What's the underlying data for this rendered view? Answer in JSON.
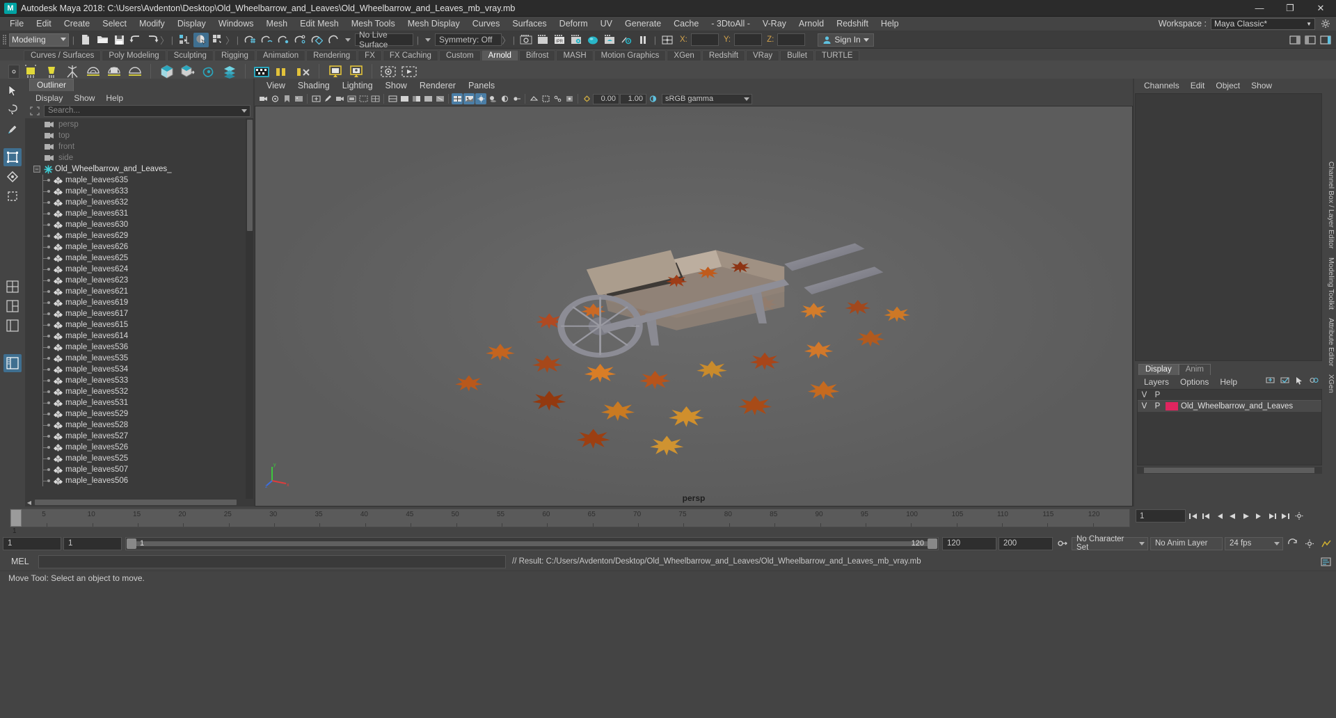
{
  "titlebar": {
    "logo": "M",
    "title": "Autodesk Maya 2018: C:\\Users\\Avdenton\\Desktop\\Old_Wheelbarrow_and_Leaves\\Old_Wheelbarrow_and_Leaves_mb_vray.mb",
    "minimize": "—",
    "maximize": "❐",
    "close": "✕"
  },
  "menubar": {
    "items": [
      "File",
      "Edit",
      "Create",
      "Select",
      "Modify",
      "Display",
      "Windows",
      "Mesh",
      "Edit Mesh",
      "Mesh Tools",
      "Mesh Display",
      "Curves",
      "Surfaces",
      "Deform",
      "UV",
      "Generate",
      "Cache",
      "- 3DtoAll -",
      "V-Ray",
      "Arnold",
      "Redshift",
      "Help"
    ],
    "workspace_label": "Workspace :",
    "workspace_value": "Maya Classic*"
  },
  "statusline": {
    "mode": "Modeling",
    "live_surface": "No Live Surface",
    "symmetry": "Symmetry: Off",
    "axis_x": "X:",
    "axis_y": "Y:",
    "axis_z": "Z:",
    "axis_x_value": "",
    "axis_y_value": "",
    "axis_z_value": "",
    "signin": "Sign In"
  },
  "shelf": {
    "tabs": [
      "Curves / Surfaces",
      "Poly Modeling",
      "Sculpting",
      "Rigging",
      "Animation",
      "Rendering",
      "FX",
      "FX Caching",
      "Custom",
      "Arnold",
      "Bifrost",
      "MASH",
      "Motion Graphics",
      "XGen",
      "Redshift",
      "VRay",
      "Bullet",
      "TURTLE"
    ],
    "active_tab": "Arnold"
  },
  "outliner": {
    "tab": "Outliner",
    "menus": [
      "Display",
      "Show",
      "Help"
    ],
    "search_placeholder": "Search...",
    "cameras": [
      "persp",
      "top",
      "front",
      "side"
    ],
    "group": "Old_Wheelbarrow_and_Leaves_",
    "children": [
      "maple_leaves635",
      "maple_leaves633",
      "maple_leaves632",
      "maple_leaves631",
      "maple_leaves630",
      "maple_leaves629",
      "maple_leaves626",
      "maple_leaves625",
      "maple_leaves624",
      "maple_leaves623",
      "maple_leaves621",
      "maple_leaves619",
      "maple_leaves617",
      "maple_leaves615",
      "maple_leaves614",
      "maple_leaves536",
      "maple_leaves535",
      "maple_leaves534",
      "maple_leaves533",
      "maple_leaves532",
      "maple_leaves531",
      "maple_leaves529",
      "maple_leaves528",
      "maple_leaves527",
      "maple_leaves526",
      "maple_leaves525",
      "maple_leaves507",
      "maple_leaves506"
    ]
  },
  "viewport": {
    "menus": [
      "View",
      "Shading",
      "Lighting",
      "Show",
      "Renderer",
      "Panels"
    ],
    "exposure": "0.00",
    "gamma_value": "1.00",
    "color_space": "sRGB gamma",
    "camera_label": "persp",
    "axis_x": "x",
    "axis_y": "y",
    "axis_z": "z"
  },
  "channelbox": {
    "menus": [
      "Channels",
      "Edit",
      "Object",
      "Show"
    ]
  },
  "layers": {
    "tabs": [
      "Display",
      "Anim"
    ],
    "active_tab": "Display",
    "menus": [
      "Layers",
      "Options",
      "Help"
    ],
    "col_v": "V",
    "col_p": "P",
    "rows": [
      {
        "visible": "V",
        "playback": "P",
        "color": "#e0255f",
        "name": "Old_Wheelbarrow_and_Leaves"
      }
    ]
  },
  "sidetabs": [
    "Channel Box / Layer Editor",
    "Modeling Toolkit",
    "Attribute Editor",
    "XGen"
  ],
  "timeline": {
    "start_label": "1",
    "ticks": [
      1,
      5,
      10,
      15,
      20,
      25,
      30,
      35,
      40,
      45,
      50,
      55,
      60,
      65,
      70,
      75,
      80,
      85,
      90,
      95,
      100,
      105,
      110,
      115,
      120
    ],
    "current_frame": "1",
    "current_field": "1",
    "buttons": [
      "go-to-start",
      "step-back-key",
      "step-back",
      "play-backwards",
      "play-forwards",
      "step-forward",
      "step-forward-key",
      "go-to-end"
    ]
  },
  "rangeslider": {
    "anim_start": "1",
    "range_start": "1",
    "slider_min": "1",
    "slider_max": "120",
    "range_end": "120",
    "anim_end": "200",
    "character_set": "No Character Set",
    "anim_layer": "No Anim Layer",
    "fps": "24 fps"
  },
  "mel": {
    "label": "MEL",
    "input_value": "",
    "result": "// Result: C:/Users/Avdenton/Desktop/Old_Wheelbarrow_and_Leaves/Old_Wheelbarrow_and_Leaves_mb_vray.mb"
  },
  "helpline": {
    "text": "Move Tool: Select an object to move."
  }
}
